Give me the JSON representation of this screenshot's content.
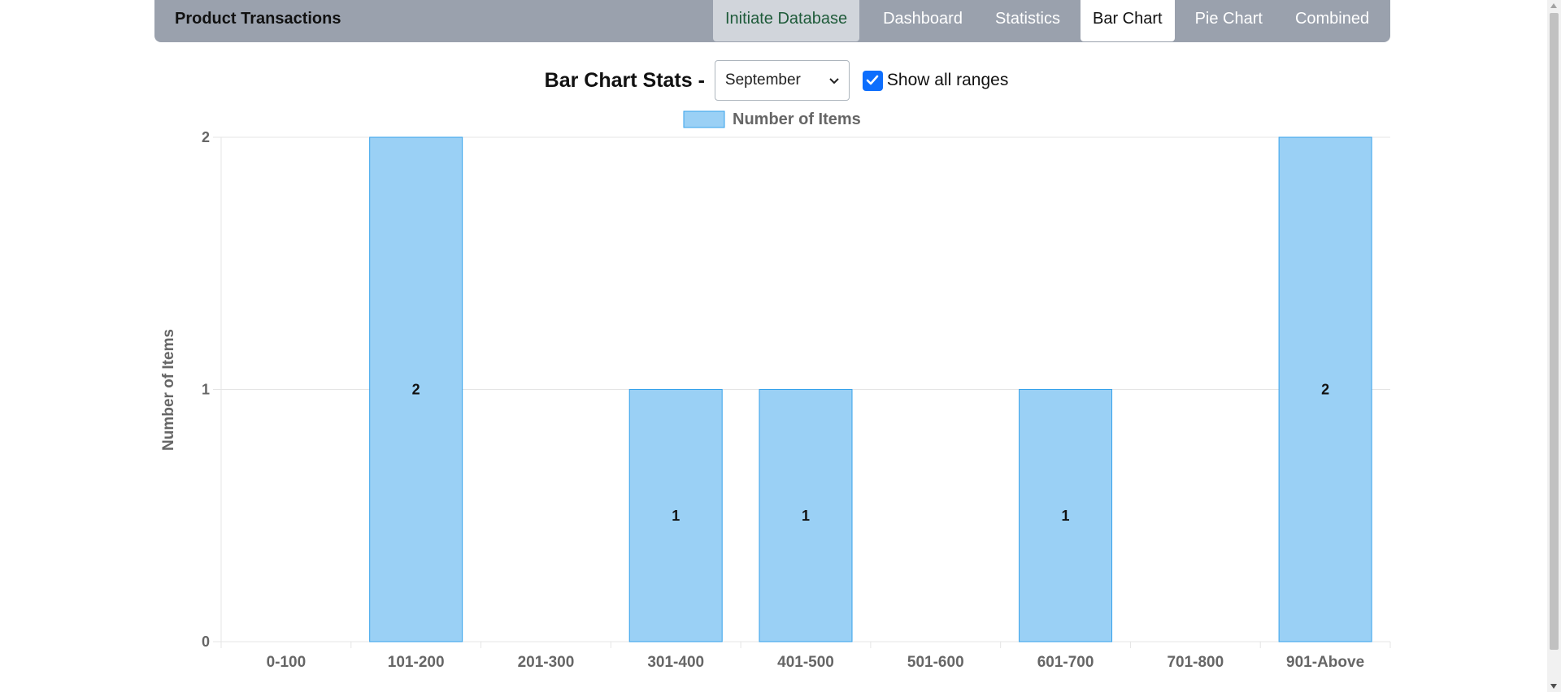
{
  "navbar": {
    "brand": "Product Transactions",
    "items": [
      {
        "label": "Initiate Database"
      },
      {
        "label": "Dashboard"
      },
      {
        "label": "Statistics"
      },
      {
        "label": "Bar Chart"
      },
      {
        "label": "Pie Chart"
      },
      {
        "label": "Combined"
      }
    ],
    "active": "Bar Chart"
  },
  "controls": {
    "title": "Bar Chart Stats -",
    "month": "September",
    "show_all_ranges_label": "Show all ranges",
    "show_all_ranges_checked": true
  },
  "colors": {
    "bar_fill": "#9ad0f5",
    "bar_stroke": "#36a2eb",
    "navbar": "#9aa1ad",
    "checkbox": "#0d6efd"
  },
  "chart_data": {
    "type": "bar",
    "categories": [
      "0-100",
      "101-200",
      "201-300",
      "301-400",
      "401-500",
      "501-600",
      "601-700",
      "701-800",
      "901-Above"
    ],
    "series": [
      {
        "name": "Number of Items",
        "values": [
          0,
          2,
          0,
          1,
          1,
          0,
          1,
          0,
          2
        ]
      }
    ],
    "data_labels": [
      "",
      "2",
      "",
      "1",
      "1",
      "",
      "1",
      "",
      "2"
    ],
    "xlabel": "",
    "ylabel": "Number of Items",
    "ylim": [
      0,
      2
    ],
    "yticks": [
      "0",
      "1",
      "2"
    ],
    "grid": true,
    "legend": "top-center"
  }
}
